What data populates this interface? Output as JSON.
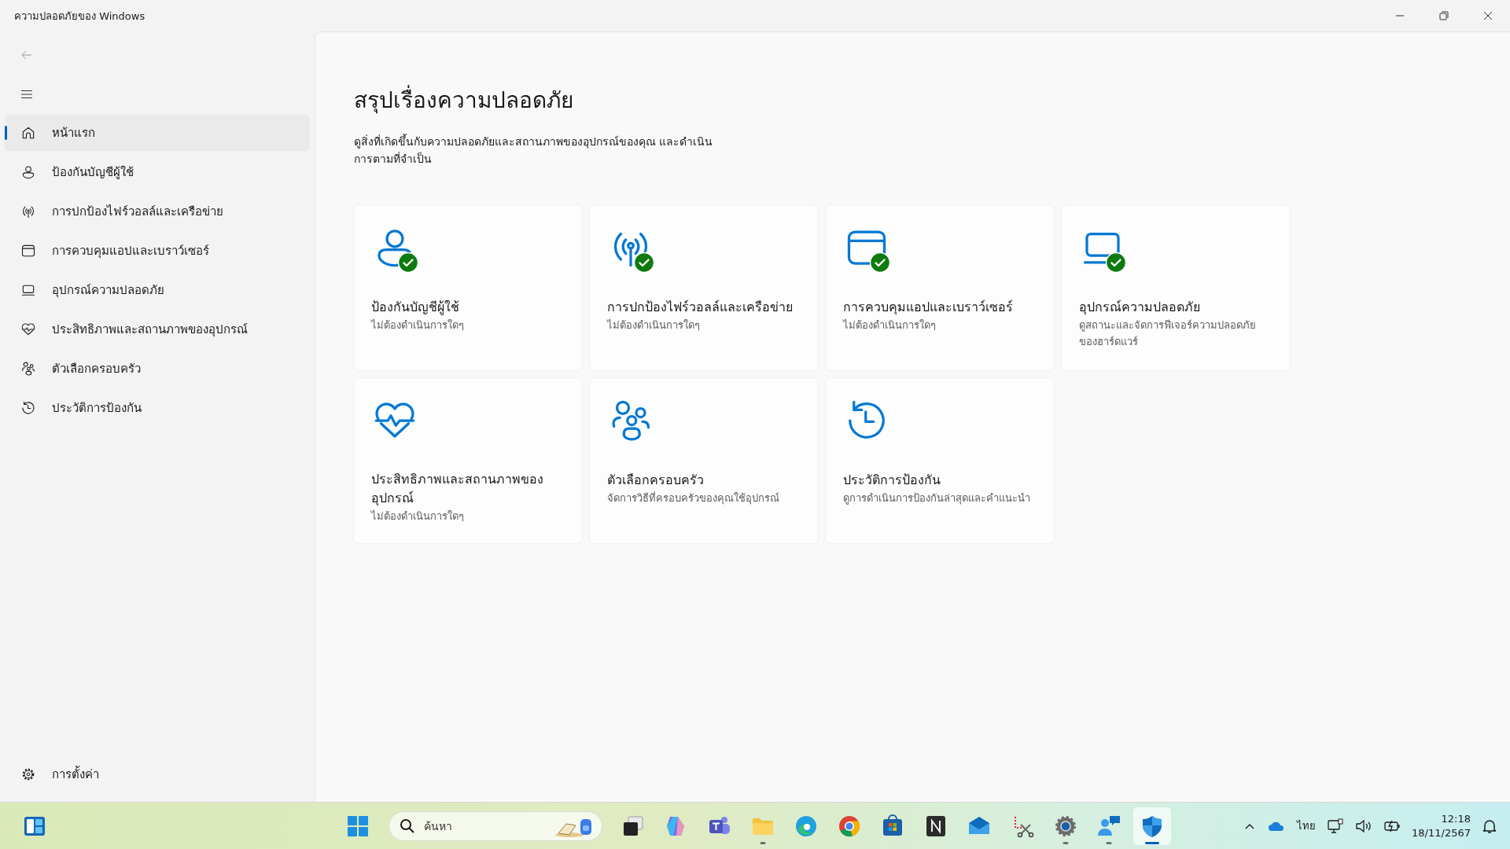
{
  "window": {
    "title": "ความปลอดภัยของ Windows"
  },
  "sidebar": {
    "items": [
      {
        "kind": "home",
        "label": "หน้าแรก",
        "selected": true
      },
      {
        "kind": "person",
        "label": "ป้องกันบัญชีผู้ใช้",
        "selected": false
      },
      {
        "kind": "antenna",
        "label": "การปกป้องไฟร์วอลล์และเครือข่าย",
        "selected": false
      },
      {
        "kind": "window",
        "label": "การควบคุมแอปและเบราว์เซอร์",
        "selected": false
      },
      {
        "kind": "laptop",
        "label": "อุปกรณ์ความปลอดภัย",
        "selected": false
      },
      {
        "kind": "heart",
        "label": "ประสิทธิภาพและสถานภาพของอุปกรณ์",
        "selected": false
      },
      {
        "kind": "family",
        "label": "ตัวเลือกครอบครัว",
        "selected": false
      },
      {
        "kind": "history",
        "label": "ประวัติการป้องกัน",
        "selected": false
      }
    ],
    "settings": {
      "label": "การตั้งค่า"
    }
  },
  "main": {
    "heading": "สรุปเรื่องความปลอดภัย",
    "description": "ดูสิ่งที่เกิดขึ้นกับความปลอดภัยและสถานภาพของอุปกรณ์ของคุณ และดำเนินการตามที่จำเป็น",
    "cards": [
      {
        "kind": "person",
        "ok": true,
        "title": "ป้องกันบัญชีผู้ใช้",
        "subtitle": "ไม่ต้องดำเนินการใดๆ"
      },
      {
        "kind": "antenna",
        "ok": true,
        "title": "การปกป้องไฟร์วอลล์และเครือข่าย",
        "subtitle": "ไม่ต้องดำเนินการใดๆ"
      },
      {
        "kind": "window",
        "ok": true,
        "title": "การควบคุมแอปและเบราว์เซอร์",
        "subtitle": "ไม่ต้องดำเนินการใดๆ"
      },
      {
        "kind": "laptop",
        "ok": true,
        "title": "อุปกรณ์ความปลอดภัย",
        "subtitle": "ดูสถานะและจัดการฟีเจอร์ความปลอดภัยของฮาร์ดแวร์"
      },
      {
        "kind": "heart",
        "ok": false,
        "title": "ประสิทธิภาพและสถานภาพของอุปกรณ์",
        "subtitle": "ไม่ต้องดำเนินการใดๆ"
      },
      {
        "kind": "family",
        "ok": false,
        "title": "ตัวเลือกครอบครัว",
        "subtitle": "จัดการวิธีที่ครอบครัวของคุณใช้อุปกรณ์"
      },
      {
        "kind": "history",
        "ok": false,
        "title": "ประวัติการป้องกัน",
        "subtitle": "ดูการดำเนินการป้องกันล่าสุดและคำแนะนำ"
      }
    ]
  },
  "taskbar": {
    "search": {
      "placeholder": "ค้นหา"
    },
    "apps": [
      {
        "kind": "start",
        "open": false,
        "active": false
      },
      {
        "kind": "taskview",
        "open": false,
        "active": false
      },
      {
        "kind": "copilot",
        "open": false,
        "active": false
      },
      {
        "kind": "teams",
        "open": false,
        "active": false
      },
      {
        "kind": "folder",
        "open": true,
        "active": false
      },
      {
        "kind": "edge",
        "open": false,
        "active": false
      },
      {
        "kind": "chrome",
        "open": false,
        "active": false
      },
      {
        "kind": "store",
        "open": false,
        "active": false
      },
      {
        "kind": "dark",
        "open": false,
        "active": false
      },
      {
        "kind": "mail",
        "open": false,
        "active": false
      },
      {
        "kind": "snip",
        "open": false,
        "active": false
      },
      {
        "kind": "settings",
        "open": true,
        "active": false
      },
      {
        "kind": "people",
        "open": true,
        "active": false
      },
      {
        "kind": "shield",
        "open": true,
        "active": true
      }
    ],
    "language": "ไทย",
    "time": "12:18",
    "date": "18/11/2567"
  }
}
